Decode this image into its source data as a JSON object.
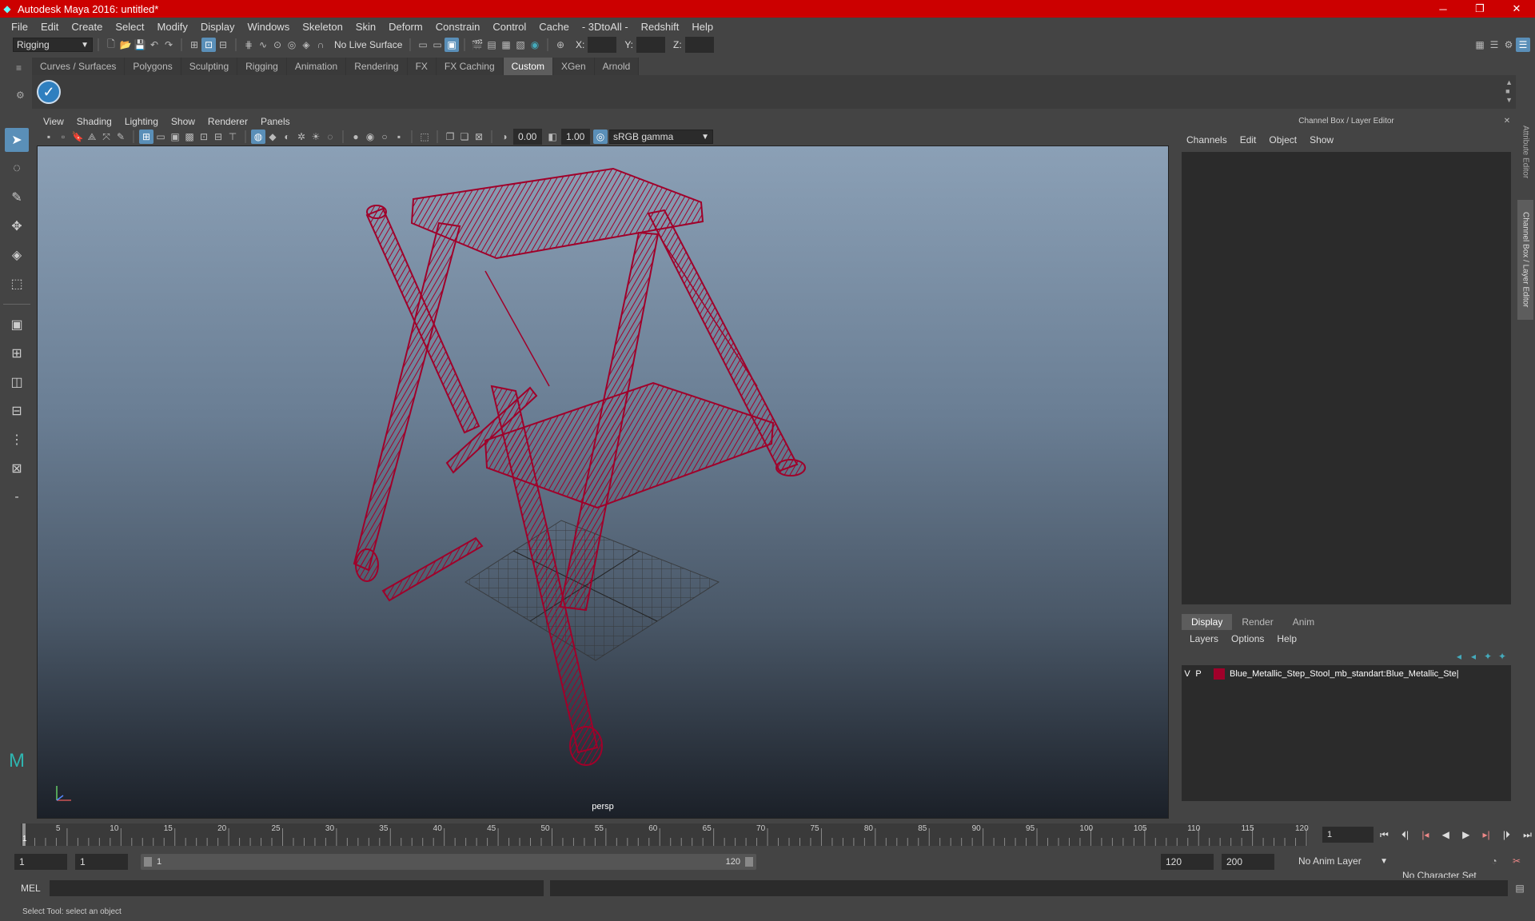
{
  "window": {
    "title": "Autodesk Maya 2016: untitled*",
    "min": "─",
    "max": "❐",
    "close": "✕"
  },
  "menubar": [
    "File",
    "Edit",
    "Create",
    "Select",
    "Modify",
    "Display",
    "Windows",
    "Skeleton",
    "Skin",
    "Deform",
    "Constrain",
    "Control",
    "Cache",
    "- 3DtoAll -",
    "Redshift",
    "Help"
  ],
  "status": {
    "menuset": "Rigging",
    "live_surface": "No Live Surface",
    "x_label": "X:",
    "y_label": "Y:",
    "z_label": "Z:"
  },
  "shelf_tabs": [
    "Curves / Surfaces",
    "Polygons",
    "Sculpting",
    "Rigging",
    "Animation",
    "Rendering",
    "FX",
    "FX Caching",
    "Custom",
    "XGen",
    "Arnold"
  ],
  "shelf_active": "Custom",
  "panel": {
    "menus": [
      "View",
      "Shading",
      "Lighting",
      "Show",
      "Renderer",
      "Panels"
    ],
    "exposure": "0.00",
    "gamma": "1.00",
    "colorspace": "sRGB gamma",
    "camera_label": "persp"
  },
  "channelbox": {
    "title": "Channel Box / Layer Editor",
    "menus": [
      "Channels",
      "Edit",
      "Object",
      "Show"
    ],
    "layer_tabs": [
      "Display",
      "Render",
      "Anim"
    ],
    "layer_menus": [
      "Layers",
      "Options",
      "Help"
    ],
    "layer": {
      "v": "V",
      "p": "P",
      "name": "Blue_Metallic_Step_Stool_mb_standart:Blue_Metallic_Ste|",
      "color": "#a0002a"
    },
    "side_tabs": [
      "Attribute Editor",
      "Channel Box / Layer Editor"
    ]
  },
  "timeline": {
    "ticks": [
      "5",
      "10",
      "15",
      "20",
      "25",
      "30",
      "35",
      "40",
      "45",
      "50",
      "55",
      "60",
      "65",
      "70",
      "75",
      "80",
      "85",
      "90",
      "95",
      "100",
      "105",
      "110",
      "115",
      "120"
    ],
    "start_marker": "1",
    "current_frame": "1"
  },
  "range": {
    "start": "1",
    "playback_start": "1",
    "slider_start": "1",
    "slider_end": "120",
    "playback_end": "120",
    "end": "200",
    "anim_layer": "No Anim Layer",
    "char_set": "No Character Set"
  },
  "cmd": {
    "lang": "MEL"
  },
  "help_line": "Select Tool: select an object",
  "colors": {
    "titlebar": "#cc0000",
    "wire": "#a0002a",
    "accent": "#5a8fb8"
  }
}
